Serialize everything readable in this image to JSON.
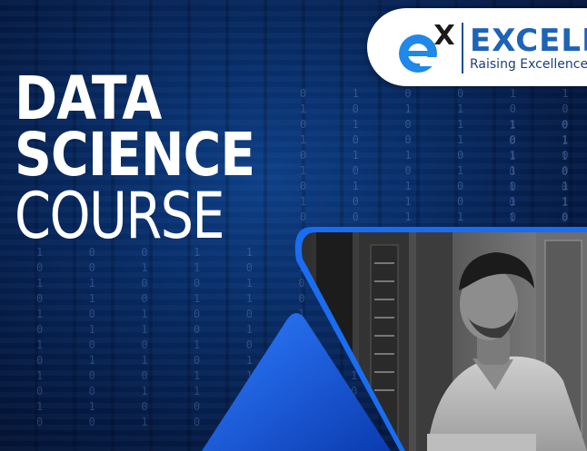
{
  "title": {
    "line1": "DATA",
    "line2": "SCIENCE",
    "line3": "COURSE"
  },
  "logo": {
    "name": "EXCELR",
    "tagline": "Raising Excellence",
    "icon": "excelr-e-x-icon"
  },
  "photo": {
    "subject": "man-working-on-laptop-in-server-room-icon"
  },
  "colors": {
    "background": "#051a42",
    "accent_blue": "#1a5fd6",
    "logo_blue": "#1d63b8",
    "title": "#ffffff"
  }
}
